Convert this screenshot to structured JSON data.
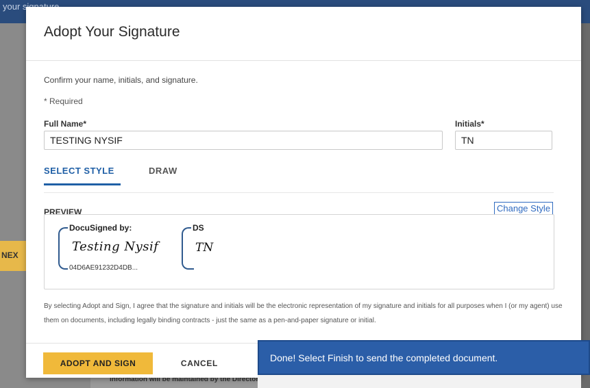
{
  "background": {
    "topbar_text": "your signature",
    "next_button": "NEX",
    "doc_text": "information will be maintained by the Director of"
  },
  "modal": {
    "title": "Adopt Your Signature",
    "instruction": "Confirm your name, initials, and signature.",
    "required_note": "* Required",
    "full_name_label": "Full Name*",
    "full_name_value": "TESTING NYSIF",
    "initials_label": "Initials*",
    "initials_value": "TN",
    "tabs": [
      {
        "label": "SELECT STYLE",
        "active": true
      },
      {
        "label": "DRAW",
        "active": false
      }
    ],
    "preview_label": "PREVIEW",
    "change_style_label": "Change Style",
    "signature_preview": {
      "header": "DocuSigned by:",
      "script_name": "Testing Nysif",
      "doc_id": "04D6AE91232D4DB..."
    },
    "initials_preview": {
      "header": "DS",
      "script_initials": "TN"
    },
    "disclaimer": "By selecting Adopt and Sign, I agree that the signature and initials will be the electronic representation of my signature and initials for all purposes when I (or my agent) use them on documents, including legally binding contracts - just the same as a pen-and-paper signature or initial.",
    "adopt_button": "ADOPT AND SIGN",
    "cancel_button": "CANCEL"
  },
  "toast": {
    "message": "Done! Select Finish to send the completed document."
  },
  "colors": {
    "accent_blue": "#1f5fa6",
    "adopt_yellow": "#f0b93a",
    "toast_blue": "#2b5ea8",
    "topbar": "#2a4c7d"
  }
}
